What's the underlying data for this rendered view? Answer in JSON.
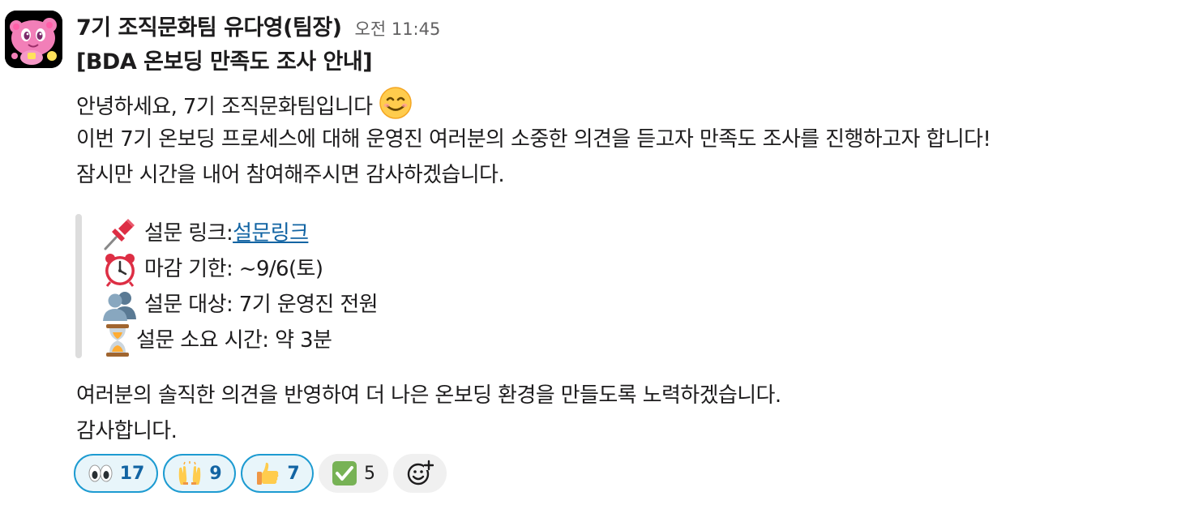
{
  "message": {
    "sender": "7기 조직문화팀 유다영(팀장)",
    "timestamp": "오전 11:45",
    "title": "[BDA 온보딩 만족도 조사 안내]",
    "intro_lines": [
      "안녕하세요, 7기 조직문화팀입니다",
      "이번 7기 온보딩 프로세스에 대해 운영진 여러분의 소중한 의견을 듣고자 만족도 조사를 진행하고자 합니다!",
      "잠시만 시간을 내어 참여해주시면 감사하겠습니다."
    ],
    "details": {
      "link_label": "설문 링크: ",
      "link_text": "설문링크",
      "deadline": "마감 기한: ~9/6(토)",
      "target": "설문 대상: 7기 운영진 전원",
      "duration": "설문 소요 시간: 약 3분"
    },
    "closing_lines": [
      "여러분의 솔직한 의견을 반영하여 더 나은 온보딩 환경을 만들도록 노력하겠습니다.",
      "감사합니다."
    ]
  },
  "icons": {
    "intro_emoji": "smiling-face-icon",
    "link": "pushpin-icon",
    "deadline": "alarm-clock-icon",
    "target": "busts-icon",
    "duration": "hourglass-icon"
  },
  "reactions": [
    {
      "emoji": "eyes-icon",
      "count": "17",
      "active": true
    },
    {
      "emoji": "raised-hands-icon",
      "count": "9",
      "active": true
    },
    {
      "emoji": "thumbs-up-icon",
      "count": "7",
      "active": true
    },
    {
      "emoji": "check-mark-button-icon",
      "count": "5",
      "active": false
    }
  ],
  "colors": {
    "link": "#1264a3",
    "reaction_active_border": "#1d9bd1",
    "reaction_active_bg": "#e8f5fa",
    "timestamp": "#616061",
    "quote_bar": "#dddddd"
  }
}
